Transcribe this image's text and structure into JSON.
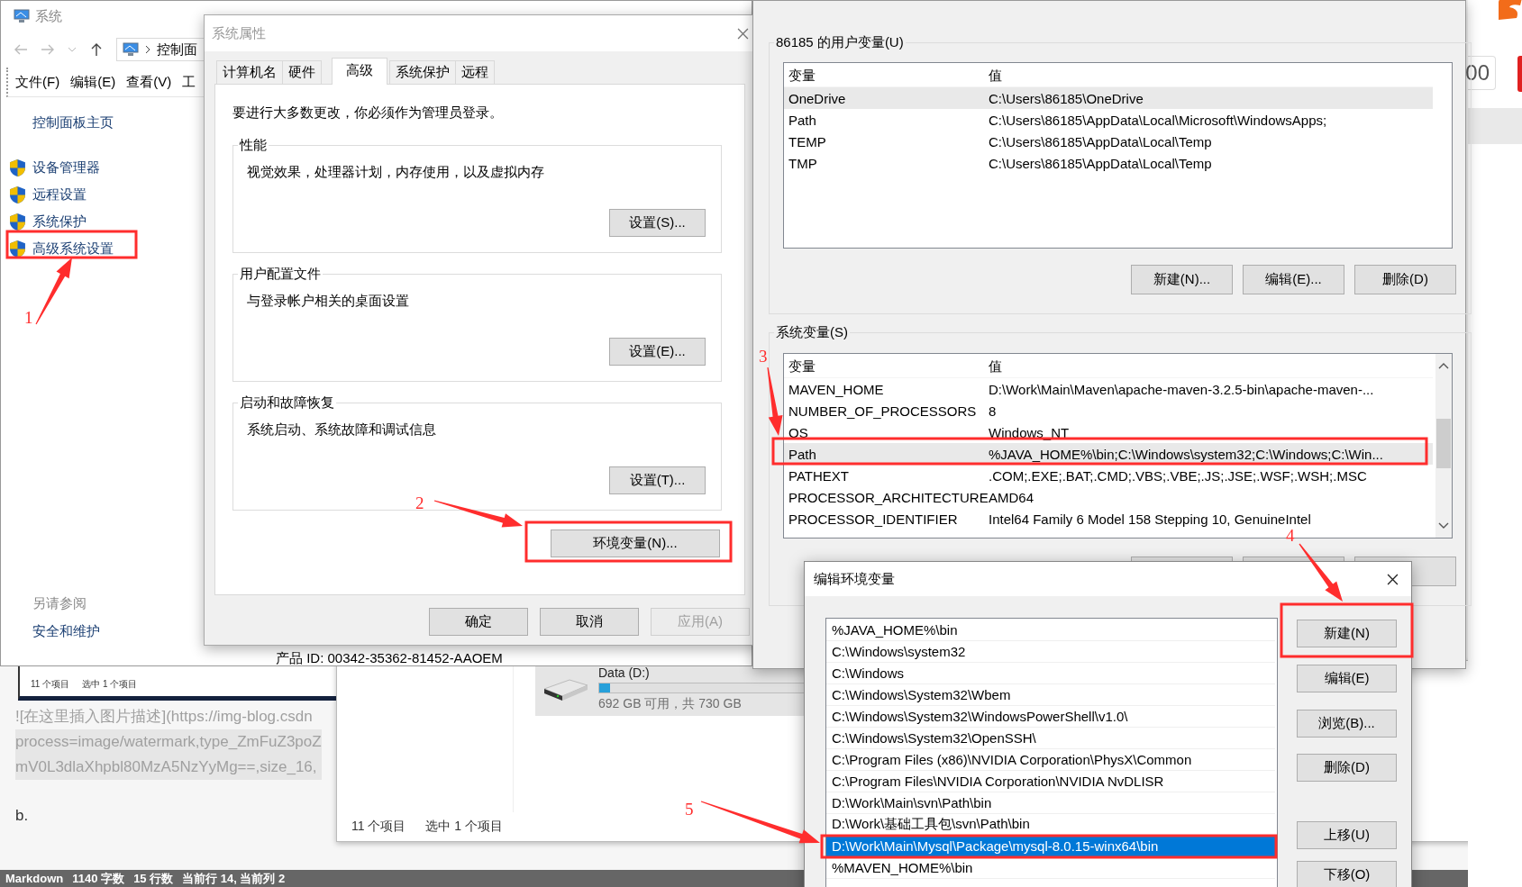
{
  "system_window": {
    "title": "系统",
    "address": "控制面",
    "menu": [
      "文件(F)",
      "编辑(E)",
      "查看(V)",
      "工"
    ],
    "home_link": "控制面板主页",
    "links": [
      "设备管理器",
      "远程设置",
      "系统保护",
      "高级系统设置"
    ],
    "see_also": "另请参阅",
    "see_also_links": [
      "安全和维护"
    ],
    "product_id": "产品 ID: 00342-35362-81452-AAOEM"
  },
  "editor": {
    "thumbnail_status": [
      "11 个项目",
      "选中 1 个项目"
    ],
    "lines": [
      "![在这里插入图片描述](https://img-blog.csdn",
      "process=image/watermark,type_ZmFuZ3poZ",
      "mV0L3dlaXhpbl80MzA5NzYyMg==,size_16,"
    ],
    "last_line": "b.",
    "status_bar": [
      "Markdown",
      "1140 字数",
      "15 行数",
      "当前行 14, 当前列 2"
    ]
  },
  "explorer": {
    "drive": {
      "name": "Data (D:)",
      "level": 0.05,
      "space": "692 GB 可用，共 730 GB"
    },
    "status": [
      "11 个项目",
      "选中 1 个项目"
    ]
  },
  "system_properties": {
    "title": "系统属性",
    "tabs": [
      {
        "label": "计算机名",
        "selected": false
      },
      {
        "label": "硬件",
        "selected": false
      },
      {
        "label": "高级",
        "selected": true
      },
      {
        "label": "系统保护",
        "selected": false
      },
      {
        "label": "远程",
        "selected": false
      }
    ],
    "notice": "要进行大多数更改，你必须作为管理员登录。",
    "groups": [
      {
        "title": "性能",
        "description": "视觉效果，处理器计划，内存使用，以及虚拟内存",
        "button": "设置(S)..."
      },
      {
        "title": "用户配置文件",
        "description": "与登录帐户相关的桌面设置",
        "button": "设置(E)..."
      },
      {
        "title": "启动和故障恢复",
        "description": "系统启动、系统故障和调试信息",
        "button": "设置(T)..."
      }
    ],
    "env_button": "环境变量(N)...",
    "buttons": [
      {
        "label": "确定",
        "disabled": false
      },
      {
        "label": "取消",
        "disabled": false
      },
      {
        "label": "应用(A)",
        "disabled": true
      }
    ]
  },
  "side_window": {
    "text": "00"
  },
  "environment_variables": {
    "user": {
      "title": "86185 的用户变量(U)",
      "columns": [
        "变量",
        "值"
      ],
      "rows": [
        {
          "name": "OneDrive",
          "value": "C:\\Users\\86185\\OneDrive",
          "selected": true
        },
        {
          "name": "Path",
          "value": "C:\\Users\\86185\\AppData\\Local\\Microsoft\\WindowsApps;",
          "selected": false
        },
        {
          "name": "TEMP",
          "value": "C:\\Users\\86185\\AppData\\Local\\Temp",
          "selected": false
        },
        {
          "name": "TMP",
          "value": "C:\\Users\\86185\\AppData\\Local\\Temp",
          "selected": false
        }
      ],
      "buttons": [
        "新建(N)...",
        "编辑(E)...",
        "删除(D)"
      ]
    },
    "system": {
      "title": "系统变量(S)",
      "columns": [
        "变量",
        "值"
      ],
      "rows": [
        {
          "name": "MAVEN_HOME",
          "value": "D:\\Work\\Main\\Maven\\apache-maven-3.2.5-bin\\apache-maven-...",
          "selected": false
        },
        {
          "name": "NUMBER_OF_PROCESSORS",
          "value": "8",
          "selected": false
        },
        {
          "name": "OS",
          "value": "Windows_NT",
          "selected": false
        },
        {
          "name": "Path",
          "value": "%JAVA_HOME%\\bin;C:\\Windows\\system32;C:\\Windows;C:\\Win...",
          "selected": true
        },
        {
          "name": "PATHEXT",
          "value": ".COM;.EXE;.BAT;.CMD;.VBS;.VBE;.JS;.JSE;.WSF;.WSH;.MSC",
          "selected": false
        },
        {
          "name": "PROCESSOR_ARCHITECTURE",
          "value": "AMD64",
          "selected": false
        },
        {
          "name": "PROCESSOR_IDENTIFIER",
          "value": "Intel64 Family 6 Model 158 Stepping 10, GenuineIntel",
          "selected": false
        }
      ]
    }
  },
  "edit_dialog": {
    "title": "编辑环境变量",
    "entries": [
      {
        "text": "%JAVA_HOME%\\bin",
        "selected": false
      },
      {
        "text": "C:\\Windows\\system32",
        "selected": false
      },
      {
        "text": "C:\\Windows",
        "selected": false
      },
      {
        "text": "C:\\Windows\\System32\\Wbem",
        "selected": false
      },
      {
        "text": "C:\\Windows\\System32\\WindowsPowerShell\\v1.0\\",
        "selected": false
      },
      {
        "text": "C:\\Windows\\System32\\OpenSSH\\",
        "selected": false
      },
      {
        "text": "C:\\Program Files (x86)\\NVIDIA Corporation\\PhysX\\Common",
        "selected": false
      },
      {
        "text": "C:\\Program Files\\NVIDIA Corporation\\NVIDIA NvDLISR",
        "selected": false
      },
      {
        "text": "D:\\Work\\Main\\svn\\Path\\bin",
        "selected": false
      },
      {
        "text": "D:\\Work\\基础工具包\\svn\\Path\\bin",
        "selected": false
      },
      {
        "text": "D:\\Work\\Main\\Mysql\\Package\\mysql-8.0.15-winx64\\bin",
        "selected": true
      },
      {
        "text": "%MAVEN_HOME%\\bin",
        "selected": false
      }
    ],
    "buttons": [
      "新建(N)",
      "编辑(E)",
      "浏览(B)...",
      "删除(D)",
      "上移(U)",
      "下移(O)"
    ]
  },
  "annotations": [
    {
      "label": "1"
    },
    {
      "label": "2"
    },
    {
      "label": "3"
    },
    {
      "label": "4"
    },
    {
      "label": "5"
    }
  ]
}
